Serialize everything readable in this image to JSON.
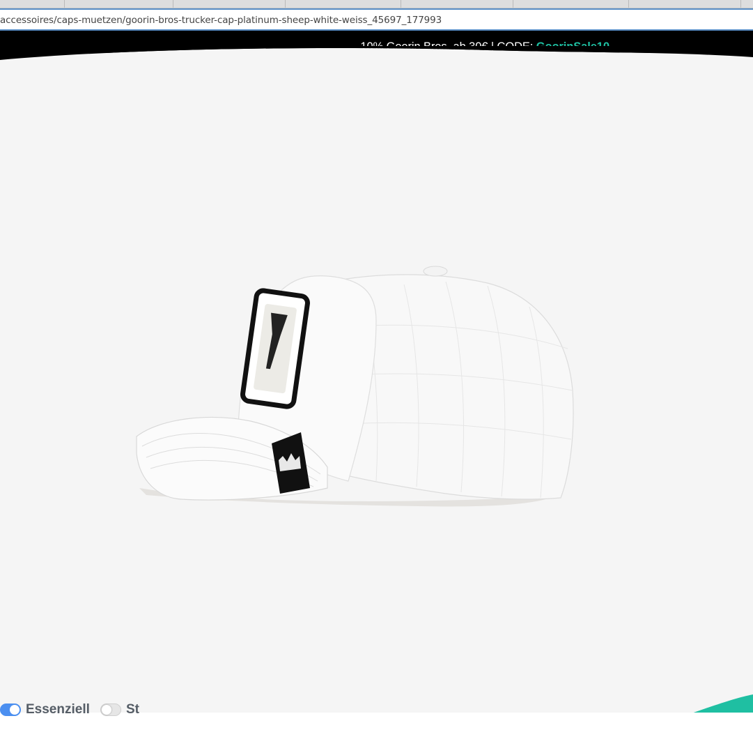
{
  "browser": {
    "url": "accessoires/caps-muetzen/goorin-bros-trucker-cap-platinum-sheep-white-weiss_45697_177993"
  },
  "promo": {
    "text": "-10% Goorin Bros. ab 30€ | CODE: ",
    "code": "GoorinSale10",
    "code_color": "#1fbfa2"
  },
  "product_image": {
    "alt": "Goorin Bros Trucker Cap Platinum Sheep White"
  },
  "cookie_settings": {
    "essential_label": "Essenziell",
    "essential_enabled": true,
    "second_label": "St",
    "second_enabled": false
  },
  "colors": {
    "accent_teal": "#1fbfa2",
    "toggle_on": "#4b8ff0",
    "hero_bg": "#f5f5f5"
  }
}
